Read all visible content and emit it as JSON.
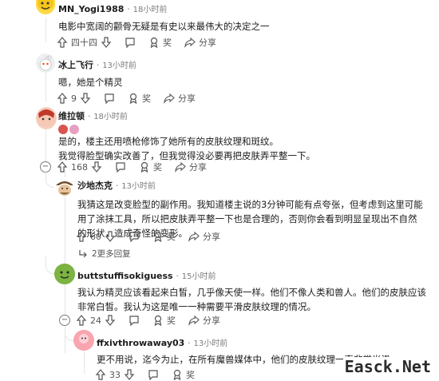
{
  "colors": {
    "text": "#1c1c1c",
    "meta": "#7c7c7c",
    "line": "#e2e5e8",
    "accent": "#ff4500"
  },
  "comments": [
    {
      "author": "MN_Yogi1988",
      "time": "18小时前",
      "body": "电影中宽阔的颧骨无疑是有史以来最伟大的决定之一",
      "votes": "四十四",
      "reply": "回复",
      "award": "奖",
      "share": "分享"
    },
    {
      "author": "冰上飞行",
      "time": "13小时前",
      "body": "嗯，她是个精灵",
      "votes": "9",
      "reply": "回复",
      "award": "奖",
      "share": "分享"
    },
    {
      "author": "维拉顿",
      "time": "18小时前",
      "body": "是的，楼主还用喷枪修饰了她所有的皮肤纹理和斑纹。\n我觉得脸型确实改善了，但我觉得没必要再把皮肤弄平整一下。",
      "votes": "168",
      "reply": "回复",
      "award": "奖",
      "share": "分享"
    },
    {
      "author": "沙地杰克",
      "time": "13小时前",
      "body": "我猜这是改变脸型的副作用。我知道楼主说的3分钟可能有点夸张，但考虑到这里可能用了涂抹工具，所以把皮肤弄平整一下也是合理的，否则你会看到明显呈现出不自然的形状，造成奇怪的变形。",
      "votes": "60",
      "reply": "回复",
      "award": "奖",
      "share": "分享",
      "more": "2更多回复"
    },
    {
      "author": "buttstuffisokiguess",
      "time": "15小时前",
      "body": "我认为精灵应该看起来白皙，几乎像天使一样。他们不像人类和兽人。他们的皮肤应该非常白皙。我认为这是唯一一种需要平滑皮肤纹理的情况。",
      "votes": "24",
      "reply": "回复",
      "award": "奖",
      "share": "分享"
    },
    {
      "author": "ffxivthrowaway03",
      "time": "13小时前",
      "body": "更不用说，迄今为止，在所有魔兽媒体中，他们的皮肤纹理一直非常光滑。",
      "votes": "33",
      "reply": "回复",
      "award": "奖",
      "share": "分享"
    }
  ],
  "watermark": "Easck.Net"
}
